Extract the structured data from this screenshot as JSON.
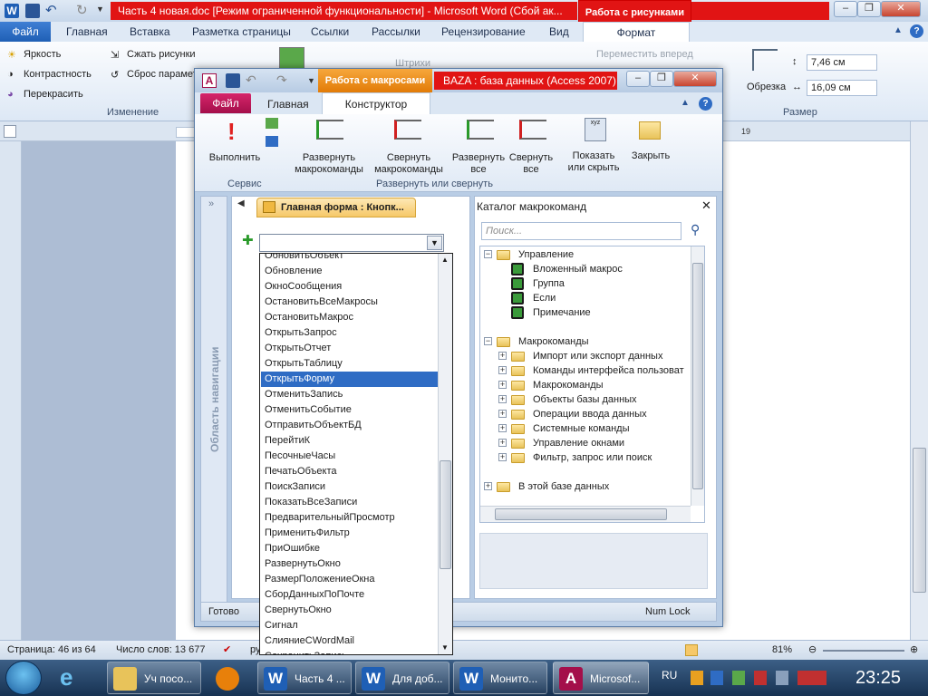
{
  "word": {
    "title": "Часть 4 новая.doc [Режим ограниченной функциональности] - Microsoft Word (Сбой ак...",
    "context_tab": "Работа с рисунками",
    "tabs": [
      "Файл",
      "Главная",
      "Вставка",
      "Разметка страницы",
      "Ссылки",
      "Рассылки",
      "Рецензирование",
      "Вид",
      "Формат"
    ],
    "ribbon": {
      "brightness": "Яркость",
      "contrast": "Контрастность",
      "recolor": "Перекрасить",
      "compress": "Сжать рисунки",
      "reset": "Сброс парамет",
      "group_change": "Изменение",
      "strokes": "Штрихи",
      "move_forward": "Переместить вперед",
      "crop": "Обрезка",
      "height": "7,46 см",
      "width": "16,09 см",
      "group_size": "Размер"
    },
    "ruler_mark": "19",
    "status": {
      "page": "Страница: 46 из 64",
      "words": "Число слов: 13 677",
      "lang": "ру",
      "zoom": "81%"
    }
  },
  "taskbar": {
    "items": [
      "Уч посо...",
      "Часть 4 ...",
      "Для доб...",
      "Монито...",
      "Microsof..."
    ],
    "lang": "RU",
    "time": "23:25"
  },
  "access": {
    "context_tab": "Работа с макросами",
    "title": "BAZA : база данных (Access 2007)",
    "tabs": {
      "file": "Файл",
      "home": "Главная",
      "constructor": "Конструктор"
    },
    "ribbon": {
      "run": "Выполнить",
      "expand_actions": [
        "Развернуть",
        "макрокоманды"
      ],
      "collapse_actions": [
        "Свернуть",
        "макрокоманды"
      ],
      "expand_all": [
        "Развернуть",
        "все"
      ],
      "collapse_all": [
        "Свернуть",
        "все"
      ],
      "show_hide": [
        "Показать",
        "или скрыть"
      ],
      "close": "Закрыть",
      "group_service": "Сервис",
      "group_expand": "Развернуть или свернуть",
      "xyz": "xyz"
    },
    "nav_pane": "Область навигации",
    "doc_tab": "Главная форма : Кнопк...",
    "status_left": "Готово",
    "status_right": "Num Lock",
    "dropdown": [
      "ОбновитьОбъект",
      "Обновление",
      "ОкноСообщения",
      "ОстановитьВсеМакросы",
      "ОстановитьМакрос",
      "ОткрытьЗапрос",
      "ОткрытьОтчет",
      "ОткрытьТаблицу",
      "ОткрытьФорму",
      "ОтменитьЗапись",
      "ОтменитьСобытие",
      "ОтправитьОбъектБД",
      "ПерейтиК",
      "ПесочныеЧасы",
      "ПечатьОбъекта",
      "ПоискЗаписи",
      "ПоказатьВсеЗаписи",
      "ПредварительныйПросмотр",
      "ПрименитьФильтр",
      "ПриОшибке",
      "РазвернутьОкно",
      "РазмерПоложениеОкна",
      "СборДанныхПоПочте",
      "СвернутьОкно",
      "Сигнал",
      "СлияниеCWordMail",
      "СохранитьЗапись"
    ],
    "dropdown_selected": "ОткрытьФорму",
    "catalog": {
      "title": "Каталог макрокоманд",
      "search_placeholder": "Поиск...",
      "control": "Управление",
      "control_items": [
        "Вложенный макрос",
        "Группа",
        "Если",
        "Примечание"
      ],
      "actions": "Макрокоманды",
      "action_items": [
        "Импорт или экспорт данных",
        "Команды интерфейса пользоват",
        "Макрокоманды",
        "Объекты базы данных",
        "Операции ввода данных",
        "Системные команды",
        "Управление окнами",
        "Фильтр, запрос или поиск"
      ],
      "in_db": "В этой базе данных"
    }
  }
}
